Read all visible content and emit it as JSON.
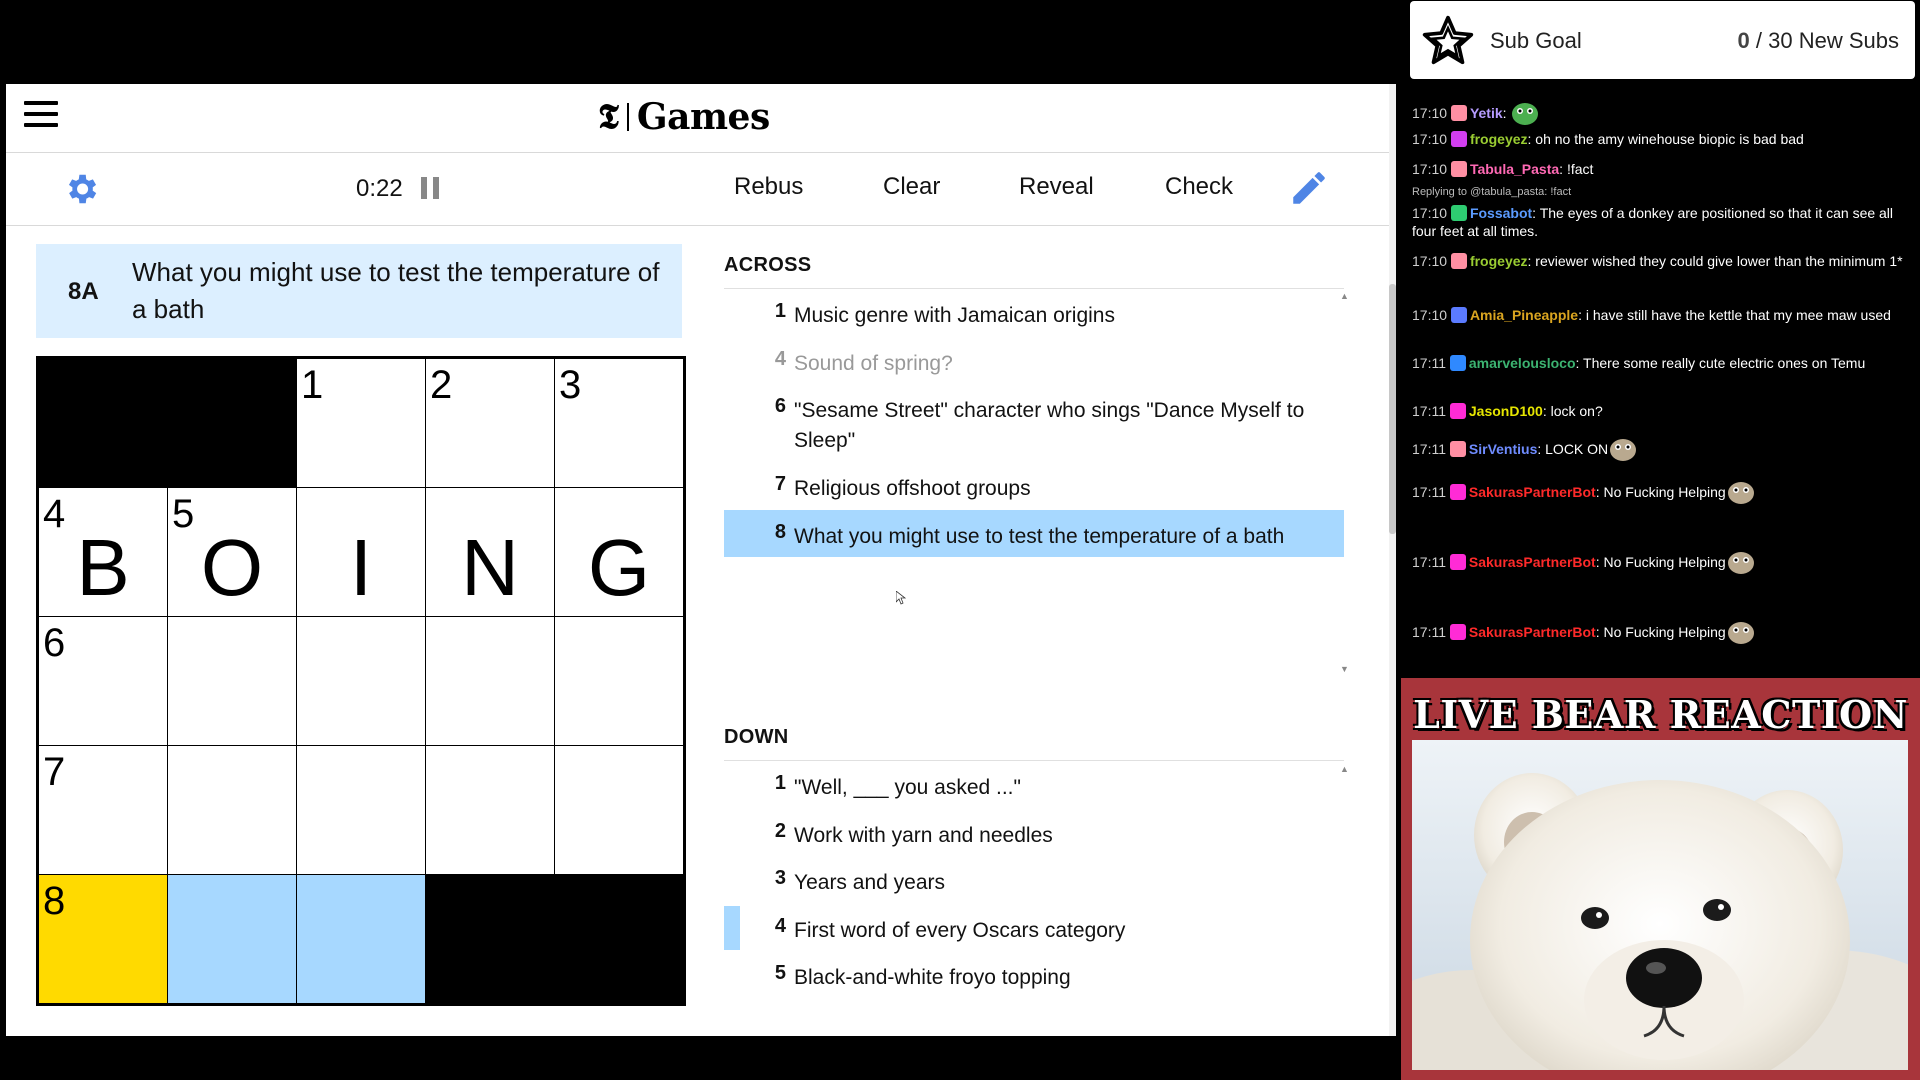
{
  "browser": {
    "brand": "Games",
    "toolbar": {
      "timer": "0:22",
      "rebus": "Rebus",
      "clear": "Clear",
      "reveal": "Reveal",
      "check": "Check"
    },
    "current_clue": {
      "number": "8A",
      "text": "What you might use to test the temperature of a bath"
    },
    "grid": {
      "numbers": [
        "",
        "",
        "1",
        "2",
        "3",
        "4",
        "5",
        "",
        "",
        "",
        "6",
        "",
        "",
        "",
        "",
        "7",
        "",
        "",
        "",
        "",
        "8",
        "",
        "",
        "",
        ""
      ],
      "letters": [
        "",
        "",
        "",
        "",
        "",
        "B",
        "O",
        "I",
        "N",
        "G",
        "",
        "",
        "",
        "",
        "",
        "",
        "",
        "",
        "",
        "",
        "",
        "",
        "",
        "",
        ""
      ],
      "black_cells": [
        0,
        1,
        23,
        24
      ],
      "selected_cell": 20,
      "highlighted_cells": [
        21,
        22
      ]
    },
    "across": {
      "title": "ACROSS",
      "clues": [
        {
          "num": "1",
          "text": "Music genre with Jamaican origins"
        },
        {
          "num": "4",
          "text": "Sound of spring?"
        },
        {
          "num": "6",
          "text": "\"Sesame Street\" character who sings \"Dance Myself to Sleep\""
        },
        {
          "num": "7",
          "text": "Religious offshoot groups"
        },
        {
          "num": "8",
          "text": "What you might use to test the temperature of a bath"
        }
      ]
    },
    "down": {
      "title": "DOWN",
      "clues": [
        {
          "num": "1",
          "text": "\"Well, ___ you asked ...\""
        },
        {
          "num": "2",
          "text": "Work with yarn and needles"
        },
        {
          "num": "3",
          "text": "Years and years"
        },
        {
          "num": "4",
          "text": "First word of every Oscars category"
        },
        {
          "num": "5",
          "text": "Black-and-white froyo topping"
        }
      ]
    }
  },
  "sub_goal": {
    "title": "Sub Goal",
    "current": "0",
    "goal_text": "/ 30 New Subs"
  },
  "chat": {
    "reply_context": "Replying to @tabula_pasta: !fact",
    "messages": [
      {
        "time": "17:10",
        "user": "Yetik",
        "color": "#b69cff",
        "text": ""
      },
      {
        "time": "17:10",
        "user": "frogeyez",
        "color": "#9acd32",
        "text": "oh no the amy winehouse biopic is bad bad"
      },
      {
        "time": "17:10",
        "user": "Tabula_Pasta",
        "color": "#ff69b4",
        "text": "!fact"
      },
      {
        "time": "17:10",
        "user": "Fossabot",
        "color": "#5b9bff",
        "text": "The eyes of a donkey are positioned so that it can see all four feet at all times."
      },
      {
        "time": "17:10",
        "user": "frogeyez",
        "color": "#9acd32",
        "text": "reviewer wished they could give lower than the minimum 1*"
      },
      {
        "time": "17:10",
        "user": "Amia_Pineapple",
        "color": "#daa520",
        "text": "i have still have the kettle that my mee maw used"
      },
      {
        "time": "17:11",
        "user": "amarvelousloco",
        "color": "#3cb371",
        "text": "There some really cute electric ones on Temu"
      },
      {
        "time": "17:11",
        "user": "JasonD100",
        "color": "#e6e600",
        "text": "lock on?"
      },
      {
        "time": "17:11",
        "user": "SirVentius",
        "color": "#6f8cff",
        "text": "LOCK ON"
      },
      {
        "time": "17:11",
        "user": "SakurasPartnerBot",
        "color": "#ff2a2a",
        "text": "No Fucking Helping"
      },
      {
        "time": "17:11",
        "user": "SakurasPartnerBot",
        "color": "#ff2a2a",
        "text": "No Fucking Helping"
      },
      {
        "time": "17:11",
        "user": "SakurasPartnerBot",
        "color": "#ff2a2a",
        "text": "No Fucking Helping"
      }
    ]
  },
  "overlay": {
    "title": "LIVE BEAR REACTION"
  }
}
